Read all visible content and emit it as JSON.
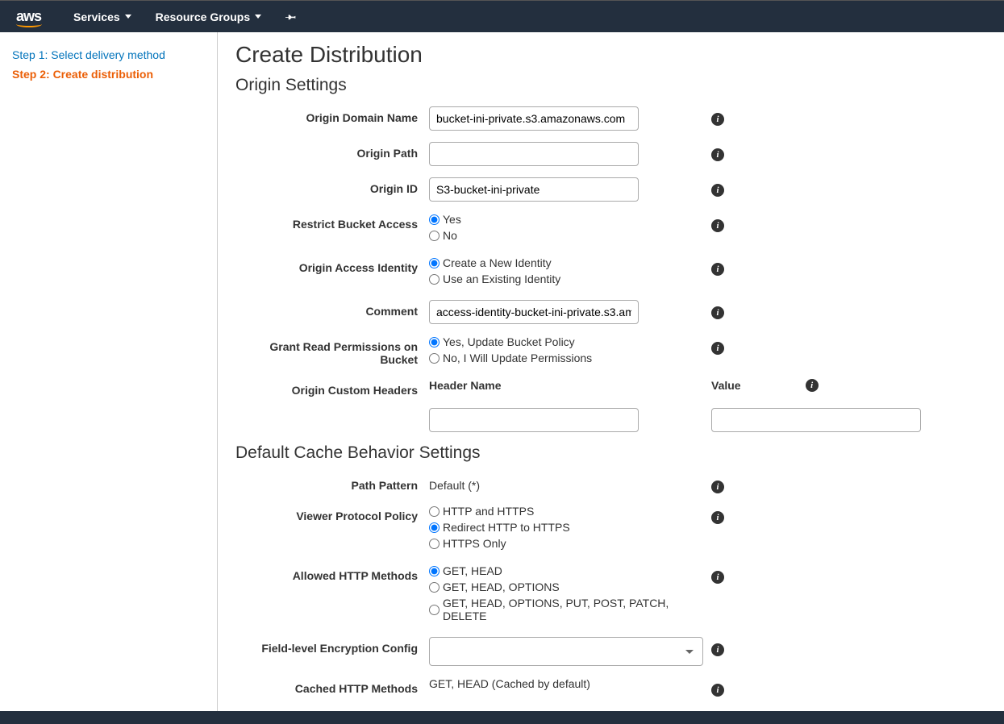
{
  "topnav": {
    "logo": "aws",
    "services": "Services",
    "resourceGroups": "Resource Groups"
  },
  "sidebar": {
    "step1": "Step 1: Select delivery method",
    "step2": "Step 2: Create distribution"
  },
  "page": {
    "title": "Create Distribution",
    "section1": "Origin Settings",
    "section2": "Default Cache Behavior Settings"
  },
  "labels": {
    "originDomainName": "Origin Domain Name",
    "originPath": "Origin Path",
    "originId": "Origin ID",
    "restrictBucketAccess": "Restrict Bucket Access",
    "originAccessIdentity": "Origin Access Identity",
    "comment": "Comment",
    "grantReadPerms": "Grant Read Permissions on Bucket",
    "originCustomHeaders": "Origin Custom Headers",
    "headerName": "Header Name",
    "value": "Value",
    "pathPattern": "Path Pattern",
    "viewerProtocolPolicy": "Viewer Protocol Policy",
    "allowedHttpMethods": "Allowed HTTP Methods",
    "fieldLevelEncryption": "Field-level Encryption Config",
    "cachedHttpMethods": "Cached HTTP Methods"
  },
  "values": {
    "originDomainName": "bucket-ini-private.s3.amazonaws.com",
    "originPath": "",
    "originId": "S3-bucket-ini-private",
    "comment": "access-identity-bucket-ini-private.s3.am",
    "pathPattern": "Default (*)",
    "cachedHttpMethods": "GET, HEAD (Cached by default)"
  },
  "options": {
    "restrictBucketAccess": {
      "yes": "Yes",
      "no": "No"
    },
    "originAccessIdentity": {
      "create": "Create a New Identity",
      "existing": "Use an Existing Identity"
    },
    "grantReadPerms": {
      "yes": "Yes, Update Bucket Policy",
      "no": "No, I Will Update Permissions"
    },
    "viewerProtocolPolicy": {
      "both": "HTTP and HTTPS",
      "redirect": "Redirect HTTP to HTTPS",
      "httpsOnly": "HTTPS Only"
    },
    "allowedHttpMethods": {
      "gh": "GET, HEAD",
      "gho": "GET, HEAD, OPTIONS",
      "all": "GET, HEAD, OPTIONS, PUT, POST, PATCH, DELETE"
    }
  }
}
